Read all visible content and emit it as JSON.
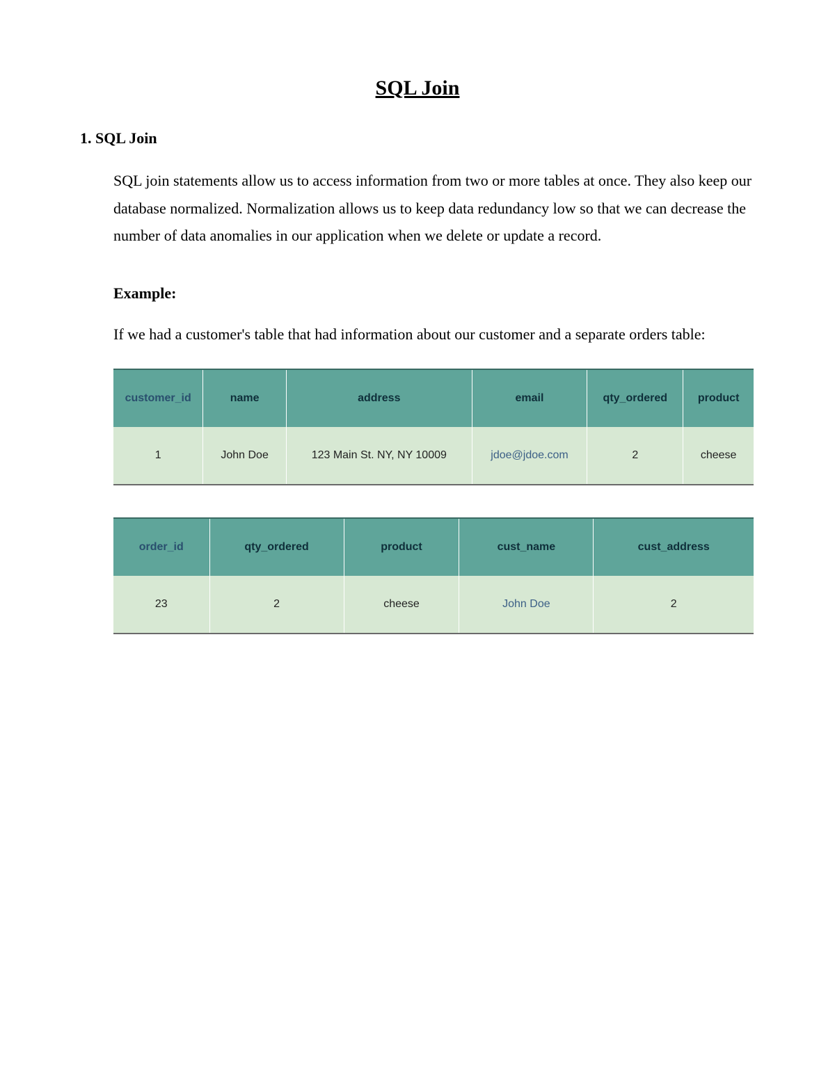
{
  "title": "SQL Join",
  "section": {
    "number": "1.",
    "heading": "SQL Join",
    "paragraph": "SQL join statements allow us to access information from two or more tables at once. They also keep our database normalized. Normalization allows us to keep data redundancy low so that we can decrease the number of data anomalies in our application when we delete or update a record.",
    "example_label": "Example:",
    "example_intro": "If we had a customer's table that had information about our customer and a separate orders table:"
  },
  "table1": {
    "headers": [
      "customer_id",
      "name",
      "address",
      "email",
      "qty_ordered",
      "product"
    ],
    "row": {
      "customer_id": "1",
      "name": "John Doe",
      "address": "123 Main St. NY, NY 10009",
      "email": "jdoe@jdoe.com",
      "qty_ordered": "2",
      "product": "cheese"
    }
  },
  "table2": {
    "headers": [
      "order_id",
      "qty_ordered",
      "product",
      "cust_name",
      "cust_address"
    ],
    "row": {
      "order_id": "23",
      "qty_ordered": "2",
      "product": "cheese",
      "cust_name": "John Doe",
      "cust_address": "2"
    }
  }
}
